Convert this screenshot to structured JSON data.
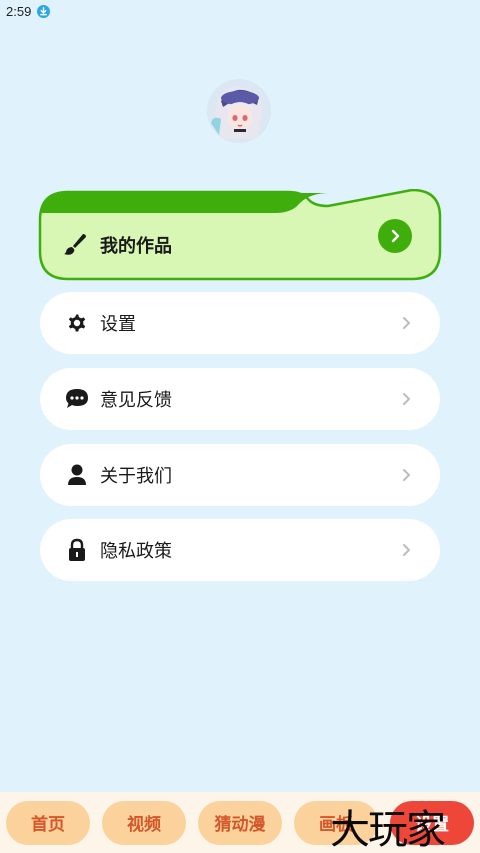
{
  "status_bar": {
    "time": "2:59",
    "download_icon": "download-icon"
  },
  "profile": {
    "avatar_icon": "anime-avatar"
  },
  "menu": {
    "works": {
      "label": "我的作品",
      "icon": "brush-icon",
      "accent": "#3fae0c",
      "fill": "#d8f7b5"
    },
    "items": [
      {
        "label": "设置",
        "icon": "gear-icon"
      },
      {
        "label": "意见反馈",
        "icon": "chat-bubble-icon"
      },
      {
        "label": "关于我们",
        "icon": "person-icon"
      },
      {
        "label": "隐私政策",
        "icon": "lock-icon"
      }
    ]
  },
  "bottom_nav": {
    "tabs": [
      {
        "label": "首页"
      },
      {
        "label": "视频"
      },
      {
        "label": "猜动漫"
      },
      {
        "label": "画板"
      },
      {
        "label": "设置",
        "active": true
      }
    ]
  },
  "watermark": {
    "text": "大玩家"
  }
}
